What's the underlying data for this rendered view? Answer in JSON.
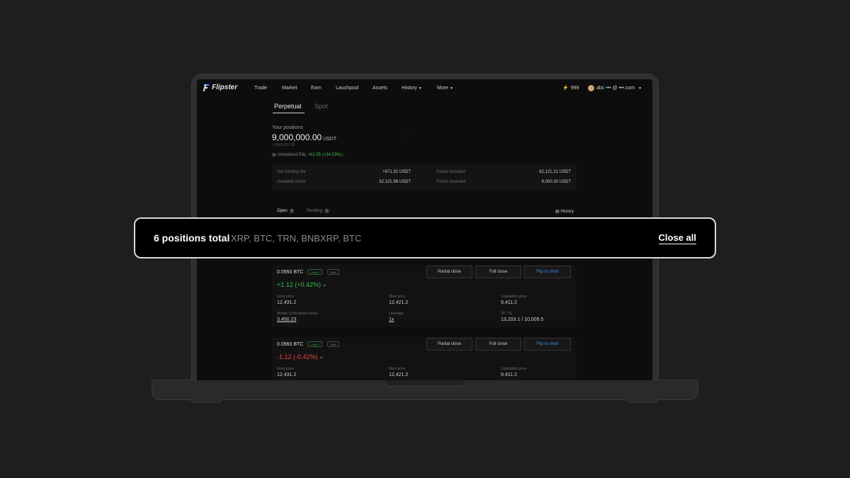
{
  "nav": {
    "brand": "Flipster",
    "items": [
      "Trade",
      "Market",
      "Earn",
      "Lauchpool",
      "Assets",
      "History",
      "More"
    ],
    "bolt": "999",
    "account": "abc ••• @ •••.com"
  },
  "tabs": [
    "Perpetual",
    "Spot"
  ],
  "positions": {
    "label": "Your positions",
    "amount": "9,000,000.00",
    "unit": "USDT",
    "sub": "≈ $905,392.20",
    "pnl_label": "Unrealized P&L",
    "pnl_value": "+61.55 (+34.53%)"
  },
  "stats": {
    "net_funding_label": "Net funding fee",
    "net_funding_value": "+671.32 USDT",
    "available_label": "Available funds",
    "available_value": "32,121.98 USDT",
    "invested_label": "Funds invested",
    "invested_value": "82,121.21 USDT",
    "reserved_label": "Funds reserved",
    "reserved_value": "6,000.30 USDT"
  },
  "subtabs": {
    "open": "Open",
    "open_count": "6",
    "pending": "Pending",
    "pending_count": "1",
    "history": "History"
  },
  "cards": [
    {
      "title": "0.0950 BTC",
      "side": "Long ↗",
      "leverage": "100x",
      "partial": "Partial close",
      "full": "Full close",
      "flip": "Flip to short",
      "pnl": "+1.12 (+0.42%)",
      "entry_label": "Entry price",
      "entry": "12,431.2",
      "mark_label": "Mark price",
      "mark": "12,421.2",
      "liq_label": "Liquidation price",
      "liq": "9,411.2",
      "margin_label": "Margin (Unrealized funds)",
      "margin": "3,450.23",
      "leverage_label": "Leverage",
      "leverage_val": "1x",
      "tpsl_label": "TP / SL",
      "tpsl": "13,203.1 / 10,009.5"
    },
    {
      "title": "0.0960 BTC",
      "side": "Long ↗",
      "leverage": "100x",
      "partial": "Partial close",
      "full": "Full close",
      "flip": "Flip to short",
      "pnl": "-1.12 (-0.42%)",
      "entry_label": "Entry price",
      "entry": "12,431.2",
      "mark_label": "Mark price",
      "mark": "12,421.2",
      "liq_label": "Liquidation price",
      "liq": "9,411.2"
    }
  ],
  "overlay": {
    "title": "6 positions total",
    "list": "XRP, BTC, TRN, BNBXRP, BTC",
    "close_all": "Close all"
  },
  "colors": {
    "accent": "#3d8cff",
    "positive": "#3fb950",
    "negative": "#e5484d"
  }
}
